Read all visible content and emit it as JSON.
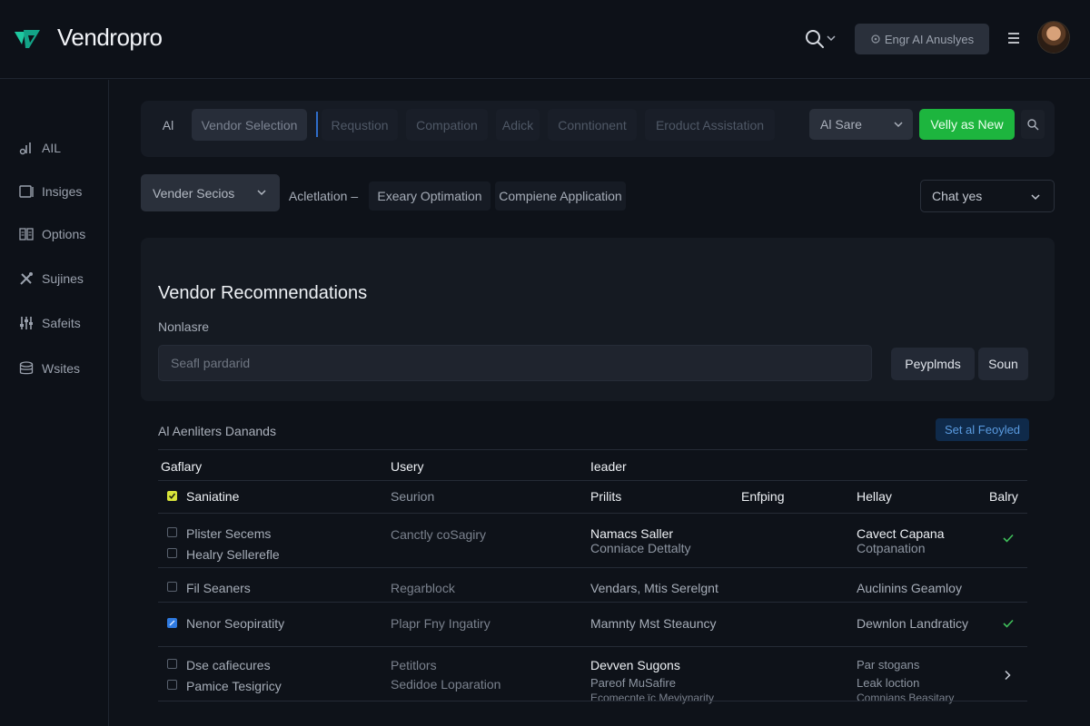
{
  "app": {
    "name": "Vendropro"
  },
  "header": {
    "ai_button_label": "Engr AI Anuslyes",
    "ai_button_icon": "ai-sparkle-icon",
    "search_icon": "search-icon",
    "menu_icon": "hamburger-menu-icon"
  },
  "sidebar": {
    "items": [
      {
        "label": "AIL",
        "icon": "analytics-icon"
      },
      {
        "label": "Insiges",
        "icon": "image-icon"
      },
      {
        "label": "Options",
        "icon": "options-icon"
      },
      {
        "label": "Sujines",
        "icon": "tools-icon"
      },
      {
        "label": "Safeits",
        "icon": "sliders-icon"
      },
      {
        "label": "Wsites",
        "icon": "database-icon"
      }
    ]
  },
  "tabs": {
    "items": [
      "Al",
      "Vendor Selection",
      "Requstion",
      "Compation",
      "Adick",
      "Conntionent",
      "Eroduct Assistation"
    ],
    "active_index": 1,
    "ai_select": "Al Sare",
    "new_button": "Velly as New"
  },
  "subnav": {
    "select": "Vender Secios",
    "items": [
      "Acletlation –",
      "Exeary Optimation",
      "Compiene Application"
    ],
    "chart_select": "Chat yes"
  },
  "recommendations": {
    "title": "Vendor Recomnendations",
    "subtitle": "Nonlasre",
    "input_placeholder": "Seafl pardarid",
    "button_primary": "Peyplmds",
    "button_secondary": "Soun"
  },
  "table_section": {
    "label": "Al Aenliters Danands",
    "action_button": "Set al Feoyled"
  },
  "table": {
    "group_headers": [
      "Gaflary",
      "Usery",
      "Ieader"
    ],
    "headers": [
      "Saniatine",
      "Seurion",
      "Prilits",
      "Enfping",
      "Hellay",
      "Balry"
    ],
    "rows": [
      {
        "col1": [
          "Plister Secems",
          "Healry Sellerefle"
        ],
        "col2": [
          "Canctly coSagiry"
        ],
        "col3": [
          "Namacs Saller",
          "Conniace Dettalty"
        ],
        "col5": [
          "Cavect Capana",
          "Cotpanation"
        ],
        "status": "check",
        "checked": false
      },
      {
        "col1": [
          "Fil Seaners"
        ],
        "col2": [
          "Regarblock"
        ],
        "col3": [
          "Vendars, Mtis Serelgnt"
        ],
        "col5": [
          "Auclinins Geamloy"
        ],
        "status": "",
        "checked": false
      },
      {
        "col1": [
          "Nenor Seopiratity"
        ],
        "col2": [
          "Plapr Fny Ingatiry"
        ],
        "col3": [
          "Mamnty Mst Steauncy"
        ],
        "col5": [
          "Dewnlon Landraticy"
        ],
        "status": "check",
        "checked": true
      },
      {
        "col1": [
          "Dse cafiecures",
          "Pamice Tesigricy"
        ],
        "col2": [
          "Petitlors",
          "Sedidoe Loparation"
        ],
        "col3": [
          "Devven Sugons",
          "Pareof MuSafire",
          "Ecomecnte ɩ̈c Meviynarity"
        ],
        "col5": [
          "Par stogans",
          "Leak loction",
          "Comnians Beasitary"
        ],
        "status": "chevron",
        "checked": false
      }
    ]
  },
  "colors": {
    "background": "#0e1219",
    "panel": "#151a22",
    "accent_green": "#1db53e",
    "accent_blue": "#2f7ae0",
    "check_green": "#3fbf5a",
    "brand_teal": "#1ec8a0"
  }
}
